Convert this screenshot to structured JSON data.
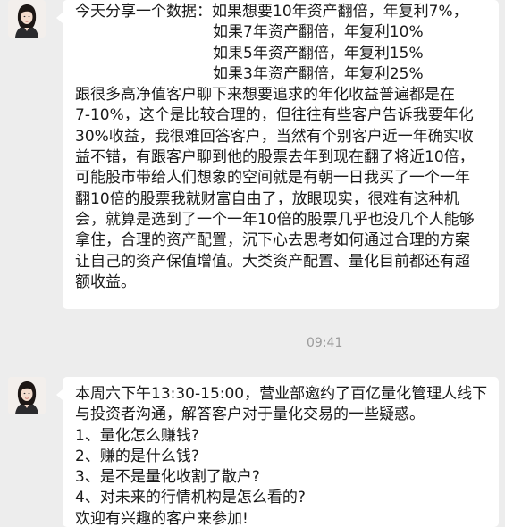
{
  "messages": [
    {
      "lines": [
        "今天分享一个数据：如果想要10年资产翻倍，年复利7%，",
        "如果7年资产翻倍，年复利10%",
        "如果5年资产翻倍，年复利15%",
        "如果3年资产翻倍，年复利25%",
        "跟很多高净值客户聊下来想要追求的年化收益普遍都是在",
        "7-10%，这个是比较合理的，但往往有些客户告诉我要年化",
        "30%收益，我很难回答客户，当然有个别客户近一年确实收",
        "益不错，有跟客户聊到他的股票去年到现在翻了将近10倍，",
        "可能股市带给人们想象的空间就是有朝一日我买了一个一年",
        "翻10倍的股票我就财富自由了，放眼现实，很难有这种机",
        "会，就算是选到了一个一年10倍的股票几乎也没几个人能够",
        "拿住，合理的资产配置，沉下心去思考如何通过合理的方案",
        "让自己的资产保值增值。大类资产配置、量化目前都还有超",
        "额收益。"
      ]
    },
    {
      "lines": [
        "本周六下午13:30-15:00，营业部邀约了百亿量化管理人线下",
        "与投资者沟通，解答客户对于量化交易的一些疑惑。",
        "1、量化怎么赚钱?",
        "2、赚的是什么钱?",
        "3、是不是量化收割了散户?",
        "4、对未来的行情机构是怎么看的?",
        "欢迎有兴趣的客户来参加!"
      ]
    }
  ],
  "timestamp": "09:41",
  "colors": {
    "background": "#ededed",
    "bubble": "#ffffff",
    "text": "#1a1a1a",
    "timestamp": "#9b9b9b"
  },
  "icons": {
    "avatar": "person-avatar"
  }
}
